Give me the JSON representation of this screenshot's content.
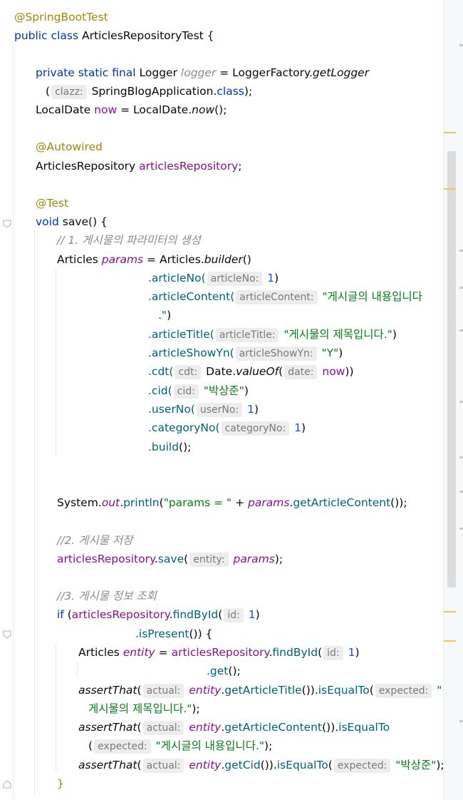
{
  "code": {
    "l1": "@SpringBootTest",
    "l2_kw": "public class",
    "l2_name": " ArticlesRepositoryTest {",
    "l3_kw": "private static final",
    "l3_type": " Logger ",
    "l3_var": "logger",
    "l3_eq": " = LoggerFactory.",
    "l3_mth": "getLogger",
    "l4_open": "(",
    "l4_hint": "clazz:",
    "l4_cls": " SpringBlogApplication.",
    "l4_kw": "class",
    "l4_end": ");",
    "l5_type": "LocalDate ",
    "l5_var": "now",
    "l5_eq": " = LocalDate.",
    "l5_mth": "now",
    "l5_end": "();",
    "l6": "@Autowired",
    "l7_type": "ArticlesRepository ",
    "l7_var": "articlesRepository",
    "l7_end": ";",
    "l8": "@Test",
    "l9_kw": "void",
    "l9_rest": " save() {",
    "l10": "// 1. 게시물의 파라미터의 생성",
    "l11_type": "Articles ",
    "l11_var": "params",
    "l11_eq": " = Articles.",
    "l11_mth": "builder",
    "l11_end": "()",
    "b1_m": ".articleNo(",
    "b1_h": "articleNo:",
    "b1_v": " 1",
    "b1_e": ")",
    "b2_m": ".articleContent(",
    "b2_h": "articleContent:",
    "b2_v": " \"게시글의 내용입니다",
    "b2_v2": ".\"",
    "b2_e": ")",
    "b3_m": ".articleTitle(",
    "b3_h": "articleTitle:",
    "b3_v": " \"게시물의 제목입니다.\"",
    "b3_e": ")",
    "b4_m": ".articleShowYn(",
    "b4_h": "articleShowYn:",
    "b4_v": " \"Y\"",
    "b4_e": ")",
    "b5_m": ".cdt(",
    "b5_h": "cdt:",
    "b5_a": " Date.",
    "b5_f": "valueOf",
    "b5_o": "(",
    "b5_h2": "date:",
    "b5_v": " now",
    "b5_e": "))",
    "b6_m": ".cid(",
    "b6_h": "cid:",
    "b6_v": " \"박상준\"",
    "b6_e": ")",
    "b7_m": ".userNo(",
    "b7_h": "userNo:",
    "b7_v": " 1",
    "b7_e": ")",
    "b8_m": ".categoryNo(",
    "b8_h": "categoryNo:",
    "b8_v": " 1",
    "b8_e": ")",
    "b9_m": ".build",
    "b9_e": "();",
    "p_a": "System.",
    "p_out": "out",
    "p_dot": ".",
    "p_mth": "println",
    "p_open": "(",
    "p_str": "\"params = \"",
    "p_plus": " + ",
    "p_var": "params",
    "p_dot2": ".",
    "p_mth2": "getArticleContent",
    "p_end": "());",
    "c2": "//2. 게시물 저장",
    "s_var": "articlesRepository",
    "s_dot": ".",
    "s_mth": "save",
    "s_open": "(",
    "s_h": "entity:",
    "s_p": " params",
    "s_end": ");",
    "c3": "//3. 게시물 정보 조회",
    "if_kw": "if",
    "if_open": " (",
    "if_var": "articlesRepository",
    "if_dot": ".",
    "if_mth": "findById",
    "if_o": "(",
    "if_h": "id:",
    "if_v": " 1",
    "if_e": ")",
    "ip_m": ".isPresent",
    "ip_e": "()) {",
    "e_type": "Articles ",
    "e_var": "entity",
    "e_eq": " = ",
    "e_repo": "articlesRepository",
    "e_dot": ".",
    "e_mth": "findById",
    "e_o": "(",
    "e_h": "id:",
    "e_v": " 1",
    "e_e": ")",
    "g_m": ".get",
    "g_e": "();",
    "a1_f": "assertThat",
    "a1_o": "(",
    "a1_h": "actual:",
    "a1_v": " entity",
    "a1_d": ".",
    "a1_m": "getArticleTitle",
    "a1_c": "()).",
    "a1_m2": "isEqualTo",
    "a1_o2": "(",
    "a1_h2": "expected:",
    "a1_s": " \"",
    "a1_s2": "게시물의 제목입니다.\"",
    "a1_e": ");",
    "a2_f": "assertThat",
    "a2_o": "(",
    "a2_h": "actual:",
    "a2_v": " entity",
    "a2_d": ".",
    "a2_m": "getArticleContent",
    "a2_c": "()).",
    "a2_m2": "isEqualTo",
    "a2_o2": "(",
    "a2_h2": "expected:",
    "a2_s": " \"게시글의 내용입니다.\"",
    "a2_e": ");",
    "a3_f": "assertThat",
    "a3_o": "(",
    "a3_h": "actual:",
    "a3_v": " entity",
    "a3_d": ".",
    "a3_m": "getCid",
    "a3_c": "()).",
    "a3_m2": "isEqualTo",
    "a3_o2": "(",
    "a3_h2": "expected:",
    "a3_s": " \"박상준\"",
    "a3_e": ");",
    "close": "}"
  },
  "colors": {
    "annotation": "#9e880d",
    "keyword": "#0033b3",
    "field": "#871094",
    "method": "#00627a",
    "string": "#067d17",
    "number": "#1750eb",
    "comment": "#8c8c8c",
    "warning_mark": "#f2c55c"
  }
}
